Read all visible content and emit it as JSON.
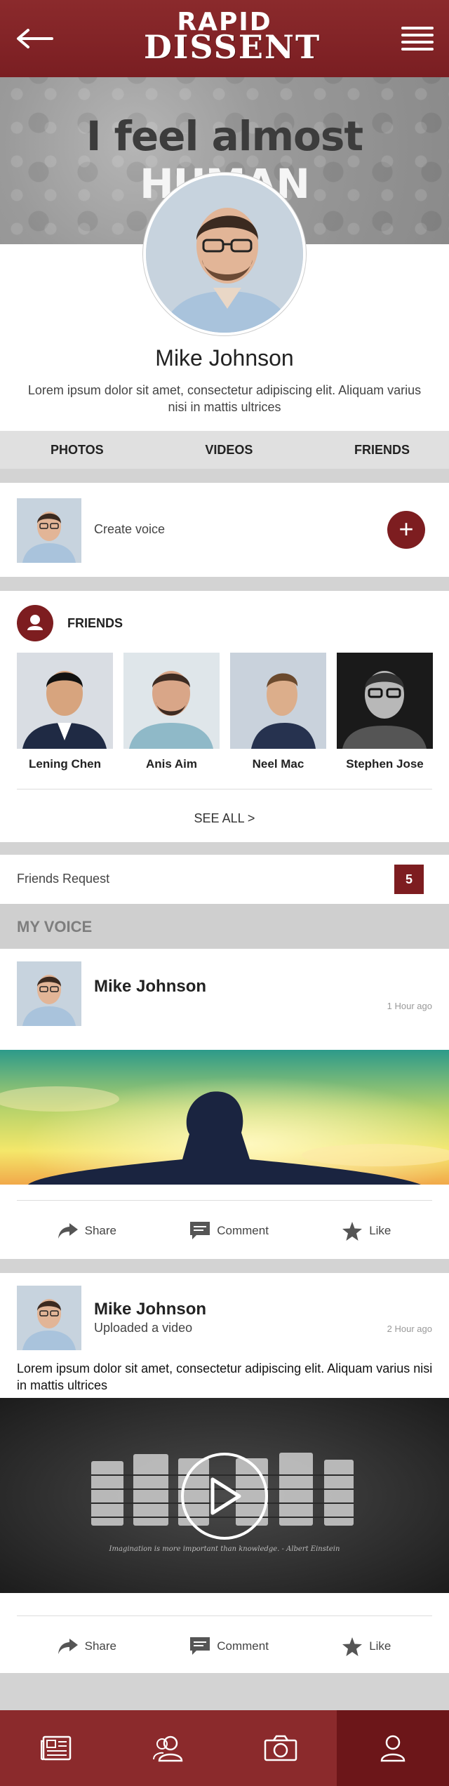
{
  "header": {
    "logo_line1": "RAPID",
    "logo_line2": "DISSENT",
    "back_icon": "arrow-left-icon",
    "menu_icon": "hamburger-menu-icon"
  },
  "banner": {
    "text_dark": "I feel almost ",
    "text_light": "HUMAN"
  },
  "profile": {
    "name": "Mike Johnson",
    "bio": "Lorem ipsum dolor sit amet, consectetur adipiscing elit. Aliquam varius nisi in mattis ultrices"
  },
  "tabs": [
    "PHOTOS",
    "VIDEOS",
    "FRIENDS"
  ],
  "create_voice": {
    "label": "Create voice",
    "button": "+"
  },
  "friends": {
    "title": "FRIENDS",
    "list": [
      {
        "name": "Lening Chen"
      },
      {
        "name": "Anis Aim"
      },
      {
        "name": "Neel Mac"
      },
      {
        "name": "Stephen Jose"
      }
    ],
    "see_all": "SEE ALL   >"
  },
  "friends_request": {
    "label": "Friends Request",
    "count": "5"
  },
  "my_voice": {
    "title": "MY VOICE"
  },
  "posts": [
    {
      "author": "Mike Johnson",
      "time": "1 Hour ago",
      "actions": {
        "share": "Share",
        "comment": "Comment",
        "like": "Like"
      }
    },
    {
      "author": "Mike Johnson",
      "subtitle": "Uploaded a video",
      "time": "2 Hour ago",
      "text": "Lorem ipsum dolor sit amet, consectetur adipiscing elit. Aliquam varius nisi in mattis ultrices",
      "video_caption": "Imagination is more important than knowledge. - Albert Einstein",
      "actions": {
        "share": "Share",
        "comment": "Comment",
        "like": "Like"
      }
    }
  ],
  "bottom_nav": [
    "news-icon",
    "friends-icon",
    "camera-icon",
    "profile-icon"
  ],
  "colors": {
    "brand": "#8b2a2c",
    "brand_dark": "#7d1d20"
  }
}
